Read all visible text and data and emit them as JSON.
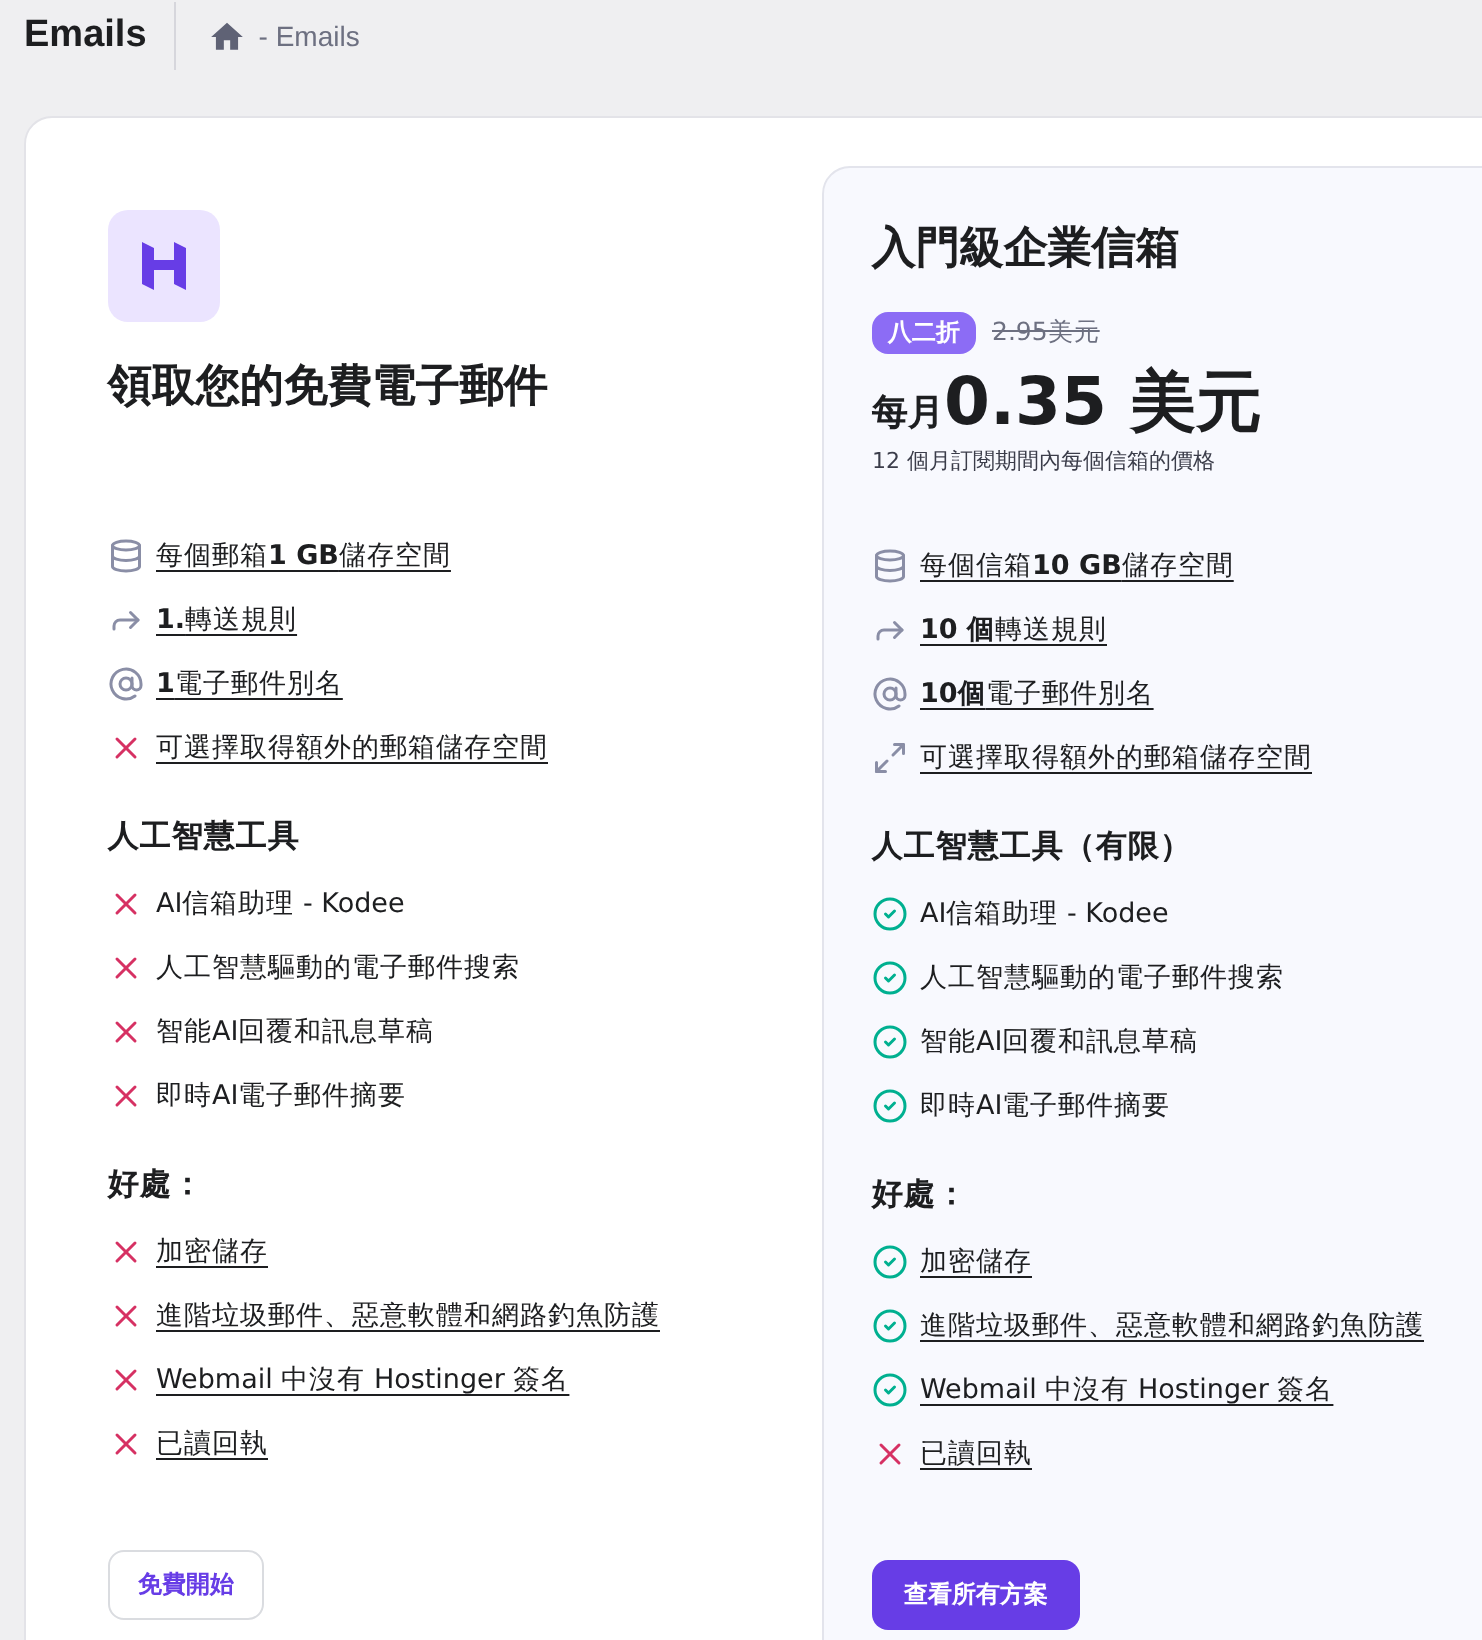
{
  "header": {
    "title": "Emails",
    "breadcrumb": "- Emails"
  },
  "free_plan": {
    "title": "領取您的免費電子郵件",
    "features": [
      {
        "kind": "storage",
        "text": "每個郵箱**1 GB**儲存空間",
        "linked": true
      },
      {
        "kind": "forward",
        "text": "**1.**轉送規則",
        "linked": true
      },
      {
        "kind": "alias",
        "text": "**1**電子郵件別名",
        "linked": true
      },
      {
        "kind": "excluded",
        "text": "可選擇取得額外的郵箱儲存空間",
        "linked": true
      }
    ],
    "sections": [
      {
        "heading": "人工智慧工具",
        "items": [
          {
            "kind": "excluded",
            "text": "AI信箱助理 - Kodee",
            "linked": false
          },
          {
            "kind": "excluded",
            "text": "人工智慧驅動的電子郵件搜索",
            "linked": false
          },
          {
            "kind": "excluded",
            "text": "智能AI回覆和訊息草稿",
            "linked": false
          },
          {
            "kind": "excluded",
            "text": "即時AI電子郵件摘要",
            "linked": false
          }
        ]
      },
      {
        "heading": "好處：",
        "items": [
          {
            "kind": "excluded",
            "text": "加密儲存",
            "linked": true
          },
          {
            "kind": "excluded",
            "text": "進階垃圾郵件、惡意軟體和網路釣魚防護",
            "linked": true
          },
          {
            "kind": "excluded",
            "text": "Webmail 中沒有 Hostinger 簽名",
            "linked": true
          },
          {
            "kind": "excluded",
            "text": "已讀回執",
            "linked": true
          }
        ]
      }
    ],
    "button": "免費開始"
  },
  "paid_plan": {
    "title": "入門級企業信箱",
    "discount": "八二折",
    "old_price": "2.95美元",
    "price_prefix": "每月",
    "price": "0.35 美元",
    "price_note": "12 個月訂閱期間內每個信箱的價格",
    "features": [
      {
        "kind": "storage",
        "text": "每個信箱**10 GB**儲存空間",
        "linked": true
      },
      {
        "kind": "forward",
        "text": "**10 個**轉送規則",
        "linked": true
      },
      {
        "kind": "alias",
        "text": "**10個**電子郵件別名",
        "linked": true
      },
      {
        "kind": "expand",
        "text": "可選擇取得額外的郵箱儲存空間",
        "linked": true
      }
    ],
    "sections": [
      {
        "heading": "人工智慧工具（有限）",
        "items": [
          {
            "kind": "included",
            "text": "AI信箱助理 - Kodee",
            "linked": false
          },
          {
            "kind": "included",
            "text": "人工智慧驅動的電子郵件搜索",
            "linked": false
          },
          {
            "kind": "included",
            "text": "智能AI回覆和訊息草稿",
            "linked": false
          },
          {
            "kind": "included",
            "text": "即時AI電子郵件摘要",
            "linked": false
          }
        ]
      },
      {
        "heading": "好處：",
        "items": [
          {
            "kind": "included",
            "text": "加密儲存",
            "linked": true
          },
          {
            "kind": "included",
            "text": "進階垃圾郵件、惡意軟體和網路釣魚防護",
            "linked": true
          },
          {
            "kind": "included",
            "text": "Webmail 中沒有 Hostinger 簽名",
            "linked": true
          },
          {
            "kind": "excluded",
            "text": "已讀回執",
            "linked": true
          }
        ]
      }
    ],
    "button": "查看所有方案"
  }
}
